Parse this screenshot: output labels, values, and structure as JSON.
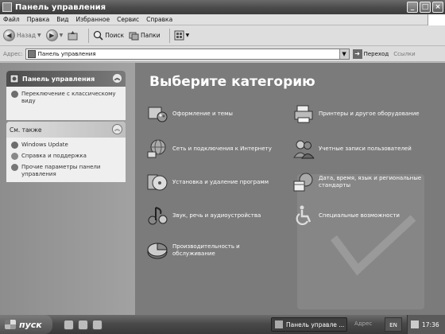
{
  "window": {
    "title": "Панель управления"
  },
  "menu": [
    "Файл",
    "Правка",
    "Вид",
    "Избранное",
    "Сервис",
    "Справка"
  ],
  "toolbar": {
    "back": "Назад",
    "search": "Поиск",
    "folders": "Папки"
  },
  "address": {
    "label": "Адрес:",
    "value": "Панель управления",
    "go": "Переход",
    "links": "Ссылки"
  },
  "left_panel": {
    "title": "Панель управления",
    "switch_view": "Переключение с классическому виду",
    "see_also_title": "См. также",
    "see_also": [
      "Windows Update",
      "Справка и поддержка",
      "Прочие параметры панели управления"
    ]
  },
  "main": {
    "heading": "Выберите категорию",
    "categories": [
      "Оформление и темы",
      "Принтеры и другое оборудование",
      "Сеть и подключения к Интернету",
      "Учетные записи пользователей",
      "Установка и удаление программ",
      "Дата, время, язык и региональные стандарты",
      "Звук, речь и аудиоустройства",
      "Специальные возможности",
      "Производительность и обслуживание"
    ]
  },
  "taskbar": {
    "start": "пуск",
    "task": "Панель управле ...",
    "address_label": "Адрес",
    "lang": "EN",
    "time": "17:36"
  }
}
